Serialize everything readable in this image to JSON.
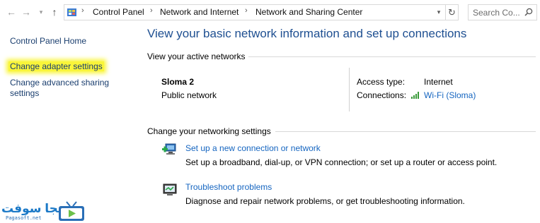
{
  "breadcrumb": {
    "items": [
      "Control Panel",
      "Network and Internet",
      "Network and Sharing Center"
    ]
  },
  "search": {
    "placeholder": "Search Co..."
  },
  "left_pane": {
    "links": [
      "Control Panel Home",
      "Change adapter settings",
      "Change advanced sharing",
      "settings"
    ]
  },
  "main": {
    "title": "View your basic network information and set up connections",
    "active_networks_heading": "View your active networks",
    "network": {
      "name": "Sloma 2",
      "category": "Public network",
      "access_type_label": "Access type:",
      "access_type_value": "Internet",
      "connections_label": "Connections:",
      "connections_value": "Wi-Fi (Sloma)"
    },
    "change_settings_heading": "Change your networking settings",
    "tasks": [
      {
        "link": "Set up a new connection or network",
        "description": "Set up a broadband, dial-up, or VPN connection; or set up a router or access point.",
        "icon": "network-setup-icon"
      },
      {
        "link": "Troubleshoot problems",
        "description": "Diagnose and repair network problems, or get troubleshooting information.",
        "icon": "troubleshoot-icon"
      }
    ]
  },
  "watermark": {
    "brand_arabic": "بيجا سوفت",
    "site": "Pagasoft.net"
  },
  "colors": {
    "title_blue": "#1e4f91",
    "link_blue": "#1565c0",
    "highlight_yellow": "#f9f53a"
  }
}
